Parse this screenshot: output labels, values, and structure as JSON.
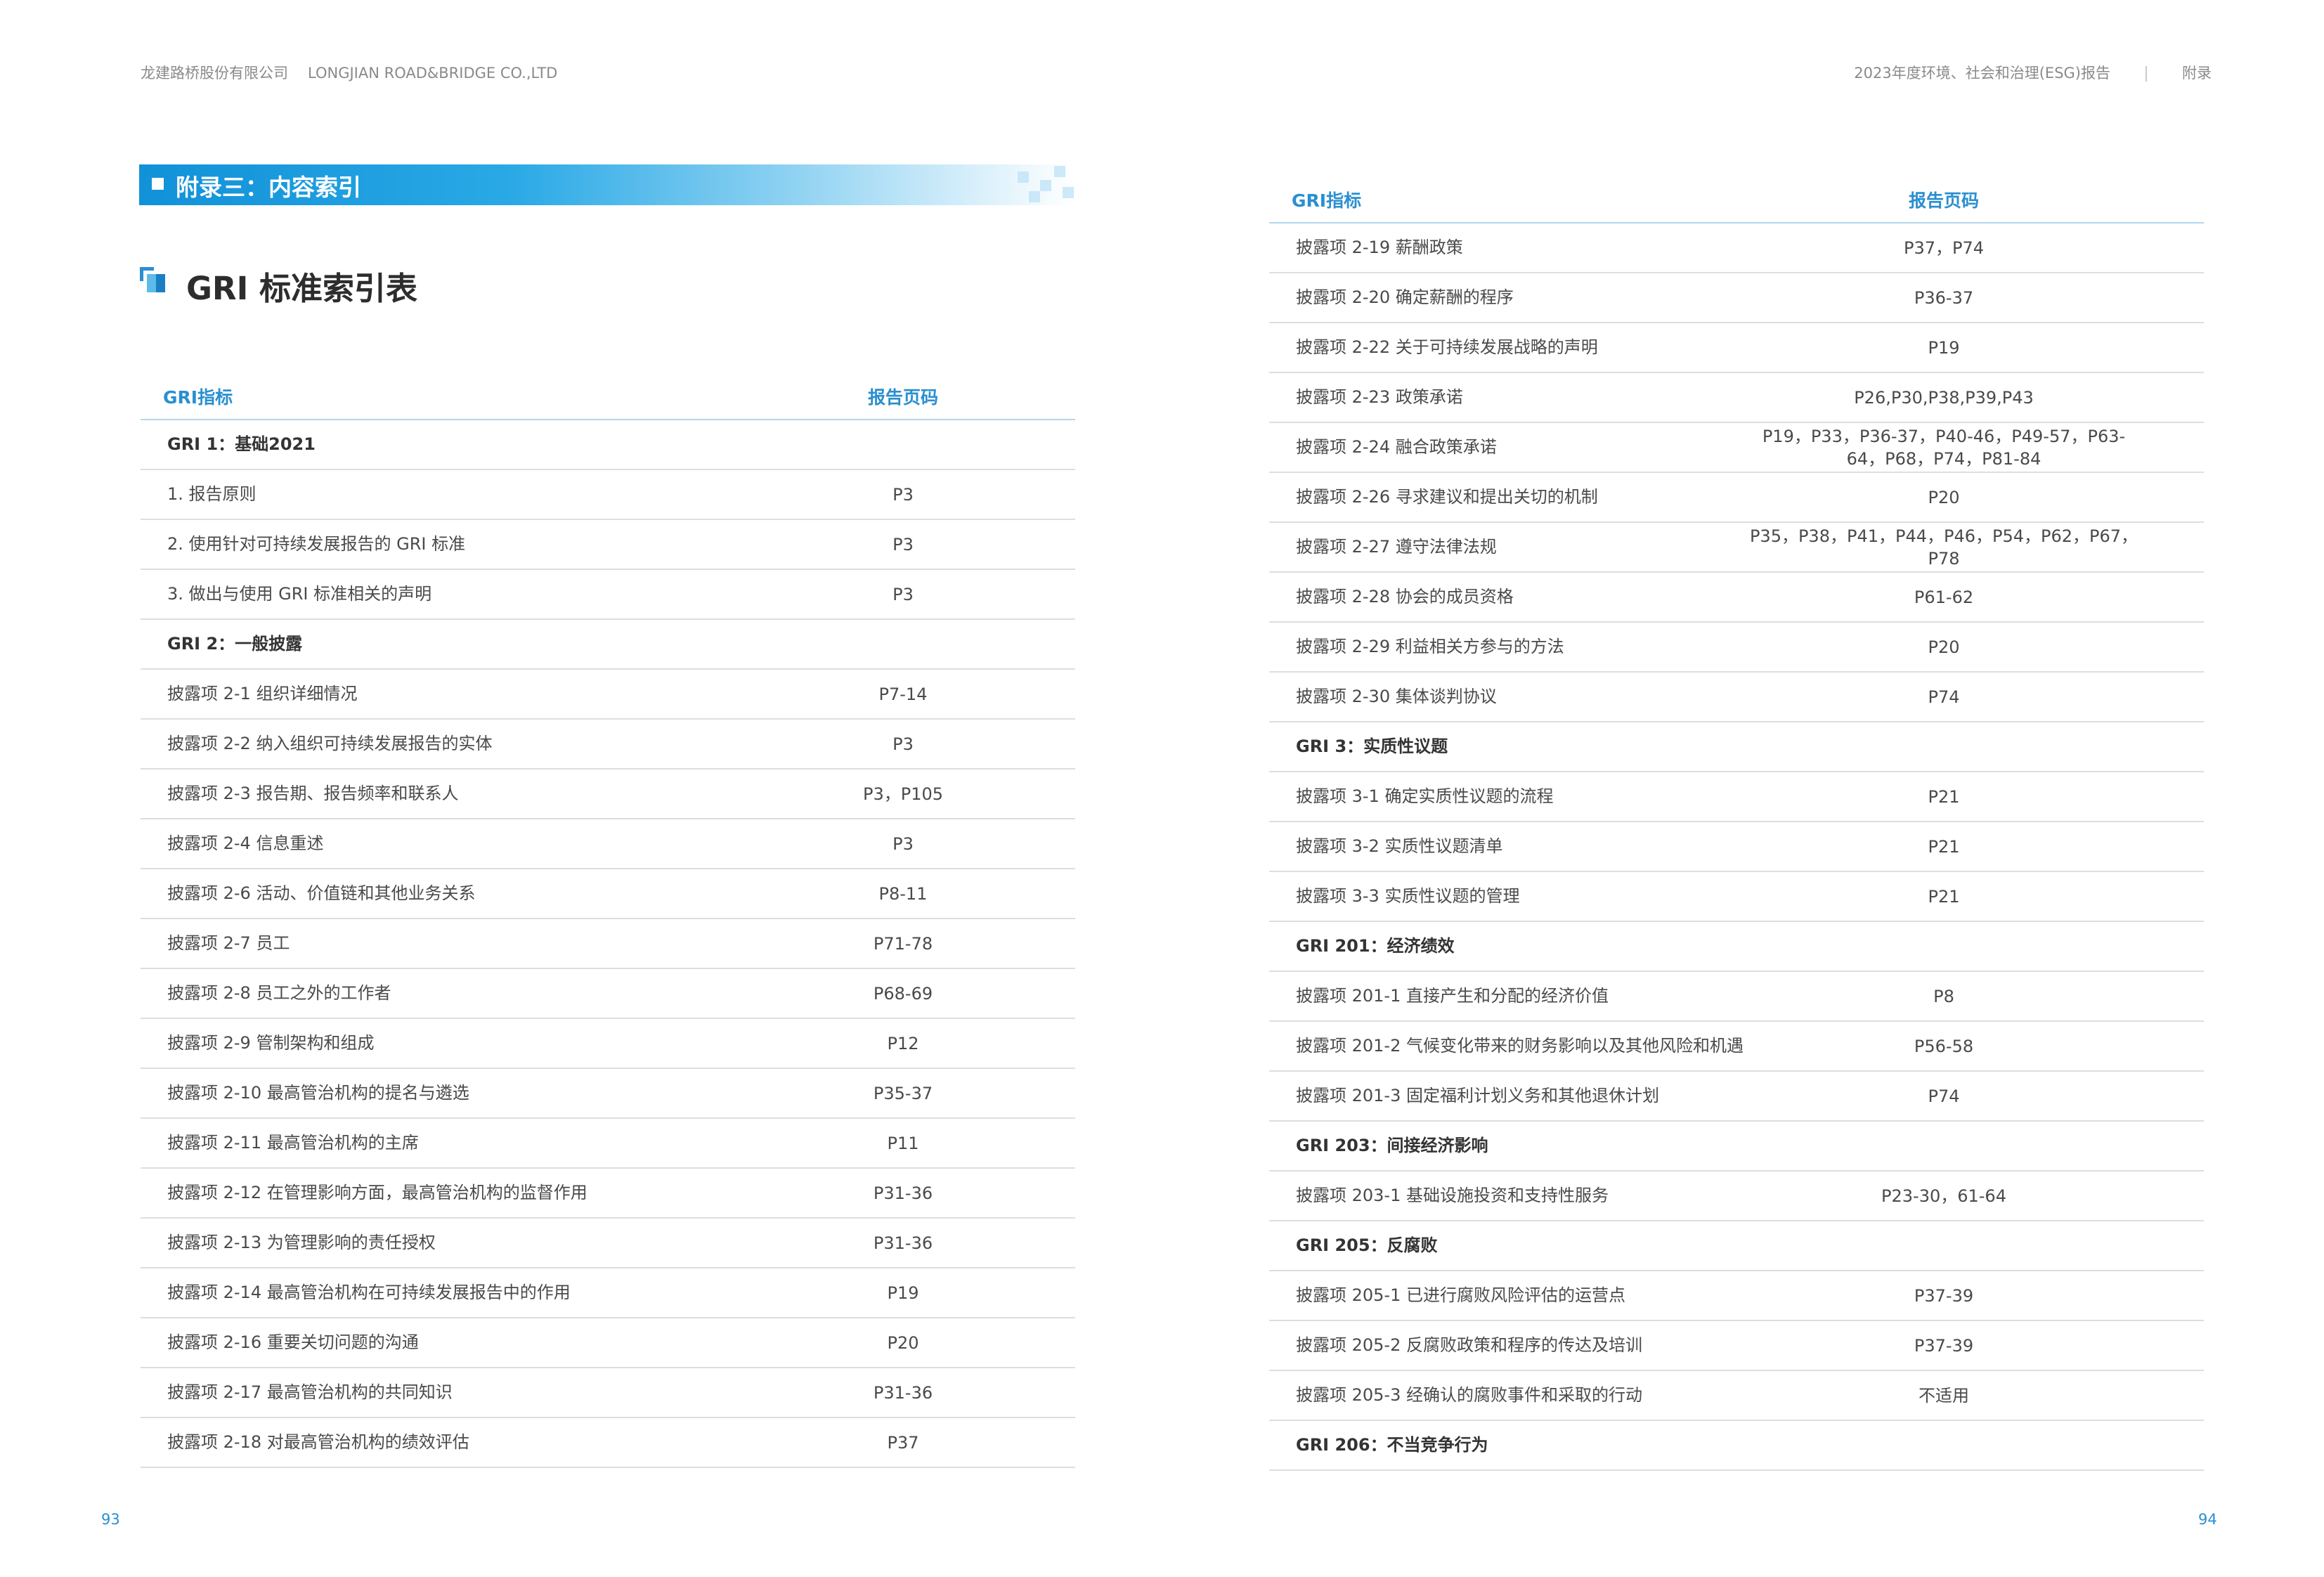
{
  "header": {
    "company_cn": "龙建路桥股份有限公司",
    "company_en": "LONGJIAN ROAD&BRIDGE CO.,LTD",
    "report_title": "2023年度环境、社会和治理(ESG)报告",
    "section": "附录"
  },
  "banner": {
    "title": "附录三：内容索引"
  },
  "section_title": "GRI 标准索引表",
  "table_headers": {
    "indicator": "GRI指标",
    "page": "报告页码"
  },
  "left_rows": [
    {
      "label": "GRI 1：基础2021",
      "page": "",
      "group": true
    },
    {
      "label": "1. 报告原则",
      "page": "P3",
      "group": false
    },
    {
      "label": "2. 使用针对可持续发展报告的 GRI 标准",
      "page": "P3",
      "group": false
    },
    {
      "label": "3. 做出与使用 GRI 标准相关的声明",
      "page": "P3",
      "group": false
    },
    {
      "label": "GRI 2：一般披露",
      "page": "",
      "group": true
    },
    {
      "label": "披露项 2-1 组织详细情况",
      "page": "P7-14",
      "group": false
    },
    {
      "label": "披露项 2-2 纳入组织可持续发展报告的实体",
      "page": "P3",
      "group": false
    },
    {
      "label": "披露项 2-3 报告期、报告频率和联系人",
      "page": "P3，P105",
      "group": false
    },
    {
      "label": "披露项 2-4 信息重述",
      "page": "P3",
      "group": false
    },
    {
      "label": "披露项 2-6 活动、价值链和其他业务关系",
      "page": "P8-11",
      "group": false
    },
    {
      "label": "披露项 2-7 员工",
      "page": "P71-78",
      "group": false
    },
    {
      "label": "披露项 2-8 员工之外的工作者",
      "page": "P68-69",
      "group": false
    },
    {
      "label": "披露项 2-9 管制架构和组成",
      "page": "P12",
      "group": false
    },
    {
      "label": "披露项 2-10 最高管治机构的提名与遴选",
      "page": "P35-37",
      "group": false
    },
    {
      "label": "披露项 2-11 最高管治机构的主席",
      "page": "P11",
      "group": false
    },
    {
      "label": "披露项 2-12 在管理影响方面，最高管治机构的监督作用",
      "page": "P31-36",
      "group": false
    },
    {
      "label": "披露项 2-13 为管理影响的责任授权",
      "page": "P31-36",
      "group": false
    },
    {
      "label": "披露项 2-14 最高管治机构在可持续发展报告中的作用",
      "page": "P19",
      "group": false
    },
    {
      "label": "披露项 2-16 重要关切问题的沟通",
      "page": "P20",
      "group": false
    },
    {
      "label": "披露项 2-17 最高管治机构的共同知识",
      "page": "P31-36",
      "group": false
    },
    {
      "label": "披露项 2-18 对最高管治机构的绩效评估",
      "page": "P37",
      "group": false
    }
  ],
  "right_rows": [
    {
      "label": "披露项 2-19 薪酬政策",
      "page": "P37，P74",
      "group": false
    },
    {
      "label": "披露项 2-20 确定薪酬的程序",
      "page": "P36-37",
      "group": false
    },
    {
      "label": "披露项 2-22 关于可持续发展战略的声明",
      "page": "P19",
      "group": false
    },
    {
      "label": "披露项 2-23 政策承诺",
      "page": "P26,P30,P38,P39,P43",
      "group": false
    },
    {
      "label": "披露项 2-24 融合政策承诺",
      "page": "P19，P33，P36-37，P40-46，P49-57，P63-64，P68，P74，P81-84",
      "group": false
    },
    {
      "label": "披露项 2-26 寻求建议和提出关切的机制",
      "page": "P20",
      "group": false
    },
    {
      "label": "披露项 2-27 遵守法律法规",
      "page": "P35，P38，P41，P44，P46，P54，P62，P67，P78",
      "group": false
    },
    {
      "label": "披露项 2-28 协会的成员资格",
      "page": "P61-62",
      "group": false
    },
    {
      "label": "披露项 2-29 利益相关方参与的方法",
      "page": "P20",
      "group": false
    },
    {
      "label": "披露项 2-30 集体谈判协议",
      "page": "P74",
      "group": false
    },
    {
      "label": "GRI 3：实质性议题",
      "page": "",
      "group": true
    },
    {
      "label": "披露项 3-1 确定实质性议题的流程",
      "page": "P21",
      "group": false
    },
    {
      "label": "披露项 3-2 实质性议题清单",
      "page": "P21",
      "group": false
    },
    {
      "label": "披露项 3-3 实质性议题的管理",
      "page": "P21",
      "group": false
    },
    {
      "label": "GRI 201：经济绩效",
      "page": "",
      "group": true
    },
    {
      "label": "披露项 201-1 直接产生和分配的经济价值",
      "page": "P8",
      "group": false
    },
    {
      "label": "披露项 201-2 气候变化带来的财务影响以及其他风险和机遇",
      "page": "P56-58",
      "group": false
    },
    {
      "label": "披露项 201-3 固定福利计划义务和其他退休计划",
      "page": "P74",
      "group": false
    },
    {
      "label": "GRI 203：间接经济影响",
      "page": "",
      "group": true
    },
    {
      "label": "披露项 203-1 基础设施投资和支持性服务",
      "page": "P23-30，61-64",
      "group": false
    },
    {
      "label": "GRI 205：反腐败",
      "page": "",
      "group": true
    },
    {
      "label": "披露项 205-1 已进行腐败风险评估的运营点",
      "page": "P37-39",
      "group": false
    },
    {
      "label": "披露项 205-2 反腐败政策和程序的传达及培训",
      "page": "P37-39",
      "group": false
    },
    {
      "label": "披露项 205-3 经确认的腐败事件和采取的行动",
      "page": "不适用",
      "group": false
    },
    {
      "label": "GRI 206：不当竞争行为",
      "page": "",
      "group": true
    }
  ],
  "page_numbers": {
    "left": "93",
    "right": "94"
  }
}
